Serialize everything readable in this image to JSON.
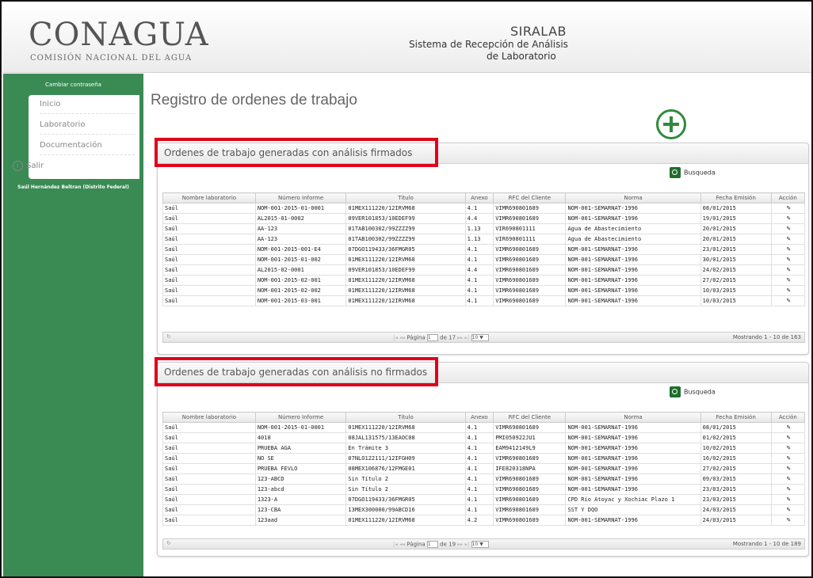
{
  "header": {
    "logo": "CONAGUA",
    "logo_subtitle": "COMISIÓN NACIONAL DEL AGUA",
    "app_name": "SIRALAB",
    "app_subtitle_line1": "Sistema de Recepción de Análisis",
    "app_subtitle_line2": "de Laboratorio"
  },
  "sidebar": {
    "change_password": "Cambiar contraseña",
    "items": [
      {
        "label": "Inicio"
      },
      {
        "label": "Laboratorio"
      },
      {
        "label": "Documentación"
      },
      {
        "label": "Salir"
      }
    ],
    "user": "Saúl Hernández Beltran (Distrito Federal)"
  },
  "main": {
    "page_title": "Registro de ordenes de trabajo",
    "columns": [
      "Nombre laboratorio",
      "Número Informe",
      "Título",
      "Anexo",
      "RFC del Cliente",
      "Norma",
      "Fecha Emisión",
      "Acción"
    ],
    "search_label": "Busqueda",
    "action_glyph": "✎",
    "pager_page_label": "Página",
    "pager_page_value": "1",
    "pager_page_size": "10 ▼"
  },
  "panels": [
    {
      "title": "Ordenes de trabajo generadas con análisis firmados",
      "total_pages": "de 17",
      "showing": "Mostrando 1 - 10 de 163",
      "rows": [
        [
          "Saúl",
          "NOM-001-2015-01-0001",
          "01MEX111220/12IRVM68",
          "4.1",
          "VIMR690801689",
          "NOM-001-SEMARNAT-1996",
          "08/01/2015"
        ],
        [
          "Saúl",
          "AL2015-01-0002",
          "09VER101853/10EDEF99",
          "4.4",
          "VIMR690801689",
          "NOM-001-SEMARNAT-1996",
          "19/01/2015"
        ],
        [
          "Saúl",
          "AA-123",
          "01TAB100302/99ZZZZ99",
          "1.13",
          "VIR690801111",
          "Agua de Abastecimiento",
          "20/01/2015"
        ],
        [
          "Saúl",
          "AA-123",
          "01TAB100302/99ZZZZ99",
          "1.13",
          "VIR690801111",
          "Agua de Abastecimiento",
          "20/01/2015"
        ],
        [
          "Saúl",
          "NOM-001-2015-001-E4",
          "07DGO119433/36FMGR05",
          "4.1",
          "VIMR690801689",
          "NOM-001-SEMARNAT-1996",
          "23/01/2015"
        ],
        [
          "Saúl",
          "NOM-001-2015-01-002",
          "01MEX111220/12IRVM68",
          "4.1",
          "VIMR690801689",
          "NOM-001-SEMARNAT-1996",
          "30/01/2015"
        ],
        [
          "Saúl",
          "AL2015-02-0001",
          "09VER101853/10EDEF99",
          "4.4",
          "VIMR690801689",
          "NOM-001-SEMARNAT-1996",
          "24/02/2015"
        ],
        [
          "Saúl",
          "NOM-001-2015-02-001",
          "01MEX111220/12IRVM68",
          "4.1",
          "VIMR690801689",
          "NOM-001-SEMARNAT-1996",
          "27/02/2015"
        ],
        [
          "Saúl",
          "NOM-001-2015-02-002",
          "01MEX111220/12IRVM68",
          "4.1",
          "VIMR690801689",
          "NOM-001-SEMARNAT-1996",
          "10/03/2015"
        ],
        [
          "Saúl",
          "NOM-001-2015-03-001",
          "01MEX111220/12IRVM68",
          "4.1",
          "VIMR690801689",
          "NOM-001-SEMARNAT-1996",
          "10/03/2015"
        ]
      ]
    },
    {
      "title": "Ordenes de trabajo generadas con análisis no firmados",
      "total_pages": "de 19",
      "showing": "Mostrando 1 - 10 de 189",
      "rows": [
        [
          "Saúl",
          "NOM-001-2015-01-0001",
          "01MEX111220/12IRVM68",
          "4.1",
          "VIMR690801689",
          "NOM-001-SEMARNAT-1996",
          "08/01/2015"
        ],
        [
          "Saúl",
          "4018",
          "08JAL131575/13EAOC08",
          "4.1",
          "PMI050922JU1",
          "NOM-001-SEMARNAT-1996",
          "01/02/2015"
        ],
        [
          "Saúl",
          "PRUEBA AGA",
          "En Trámite 3",
          "4.1",
          "EAM9412149L9",
          "NOM-001-SEMARNAT-1996",
          "10/02/2015"
        ],
        [
          "Saúl",
          "NO SE",
          "07NLO122111/12IFGH09",
          "4.1",
          "VIMR690801689",
          "NOM-001-SEMARNAT-1996",
          "16/02/2015"
        ],
        [
          "Saúl",
          "PRUEBA FEVLO",
          "08MEX106876/12FMGE01",
          "4.1",
          "IFE820318NPA",
          "NOM-001-SEMARNAT-1996",
          "27/02/2015"
        ],
        [
          "Saúl",
          "123-ABCD",
          "Sin Título 2",
          "4.1",
          "VIMR690801689",
          "NOM-001-SEMARNAT-1996",
          "09/03/2015"
        ],
        [
          "Saúl",
          "123-abcd",
          "Sin Título 2",
          "4.1",
          "VIMR690801689",
          "NOM-001-SEMARNAT-1996",
          "23/03/2015"
        ],
        [
          "Saúl",
          "1323-A",
          "07DGO119433/36FMGR05",
          "4.1",
          "VIMR690801689",
          "CPD Río Atoyac y Xochiac Plazo 1",
          "23/03/2015"
        ],
        [
          "Saúl",
          "123-CBA",
          "13MEX300000/99ABCD16",
          "4.1",
          "VIMR690801689",
          "SST Y DQO",
          "24/03/2015"
        ],
        [
          "Saúl",
          "123aad",
          "01MEX111220/12IRVM68",
          "4.2",
          "VIMR690801689",
          "NOM-001-SEMARNAT-1996",
          "24/03/2015"
        ]
      ]
    }
  ],
  "colors": {
    "sidebar": "#3a8a54",
    "highlight": "#e0001a",
    "add_button": "#2e8b3a"
  }
}
